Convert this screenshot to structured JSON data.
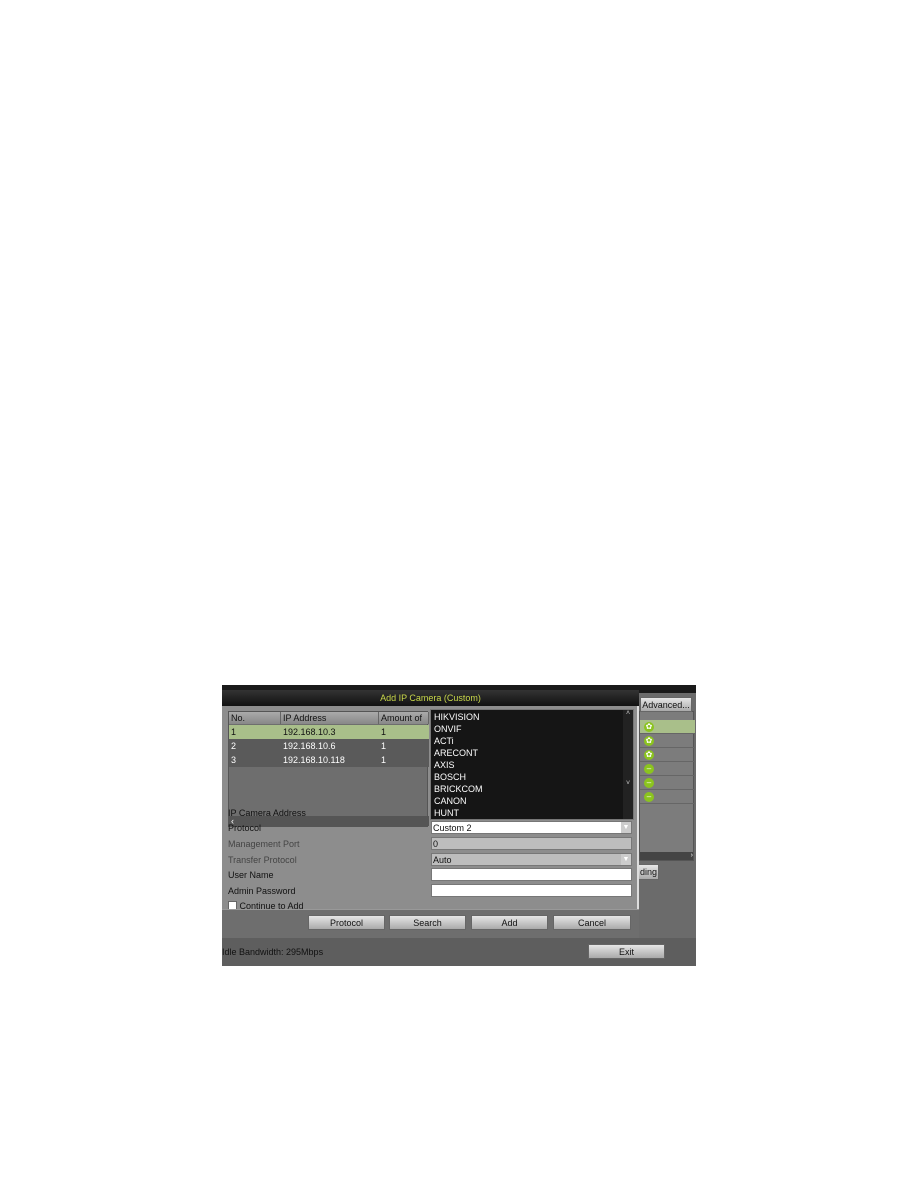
{
  "dialog": {
    "title": "Add IP Camera (Custom)"
  },
  "table": {
    "headers": [
      "No.",
      "IP Address",
      "Amount of C"
    ],
    "rows": [
      [
        "1",
        "192.168.10.3",
        "1"
      ],
      [
        "2",
        "192.168.10.6",
        "1"
      ],
      [
        "3",
        "192.168.10.118",
        "1"
      ]
    ]
  },
  "dropdown": {
    "options": [
      "HIKVISION",
      "ONVIF",
      "ACTi",
      "ARECONT",
      "AXIS",
      "BOSCH",
      "BRICKCOM",
      "CANON",
      "HUNT"
    ]
  },
  "form": {
    "ip_label": "IP Camera Address",
    "protocol_label": "Protocol",
    "protocol_value": "Custom 2",
    "port_label": "Management Port",
    "port_value": "0",
    "transfer_label": "Transfer Protocol",
    "transfer_value": "Auto",
    "user_label": "User Name",
    "user_value": "",
    "password_label": "Admin Password",
    "password_value": "",
    "continue_label": "Continue to Add"
  },
  "buttons": {
    "protocol": "Protocol",
    "search": "Search",
    "add": "Add",
    "cancel": "Cancel",
    "advanced": "Advanced...",
    "ding": "ding",
    "exit": "Exit"
  },
  "status": {
    "bandwidth": "Idle Bandwidth: 295Mbps"
  },
  "right_icons": [
    "gear-icon",
    "gear-icon",
    "gear-icon",
    "minus-icon",
    "minus-icon",
    "minus-icon"
  ],
  "colors": {
    "title_text": "#c9d84a",
    "selected_row": "#a9bf8a",
    "icon_green": "#8bc41e"
  }
}
